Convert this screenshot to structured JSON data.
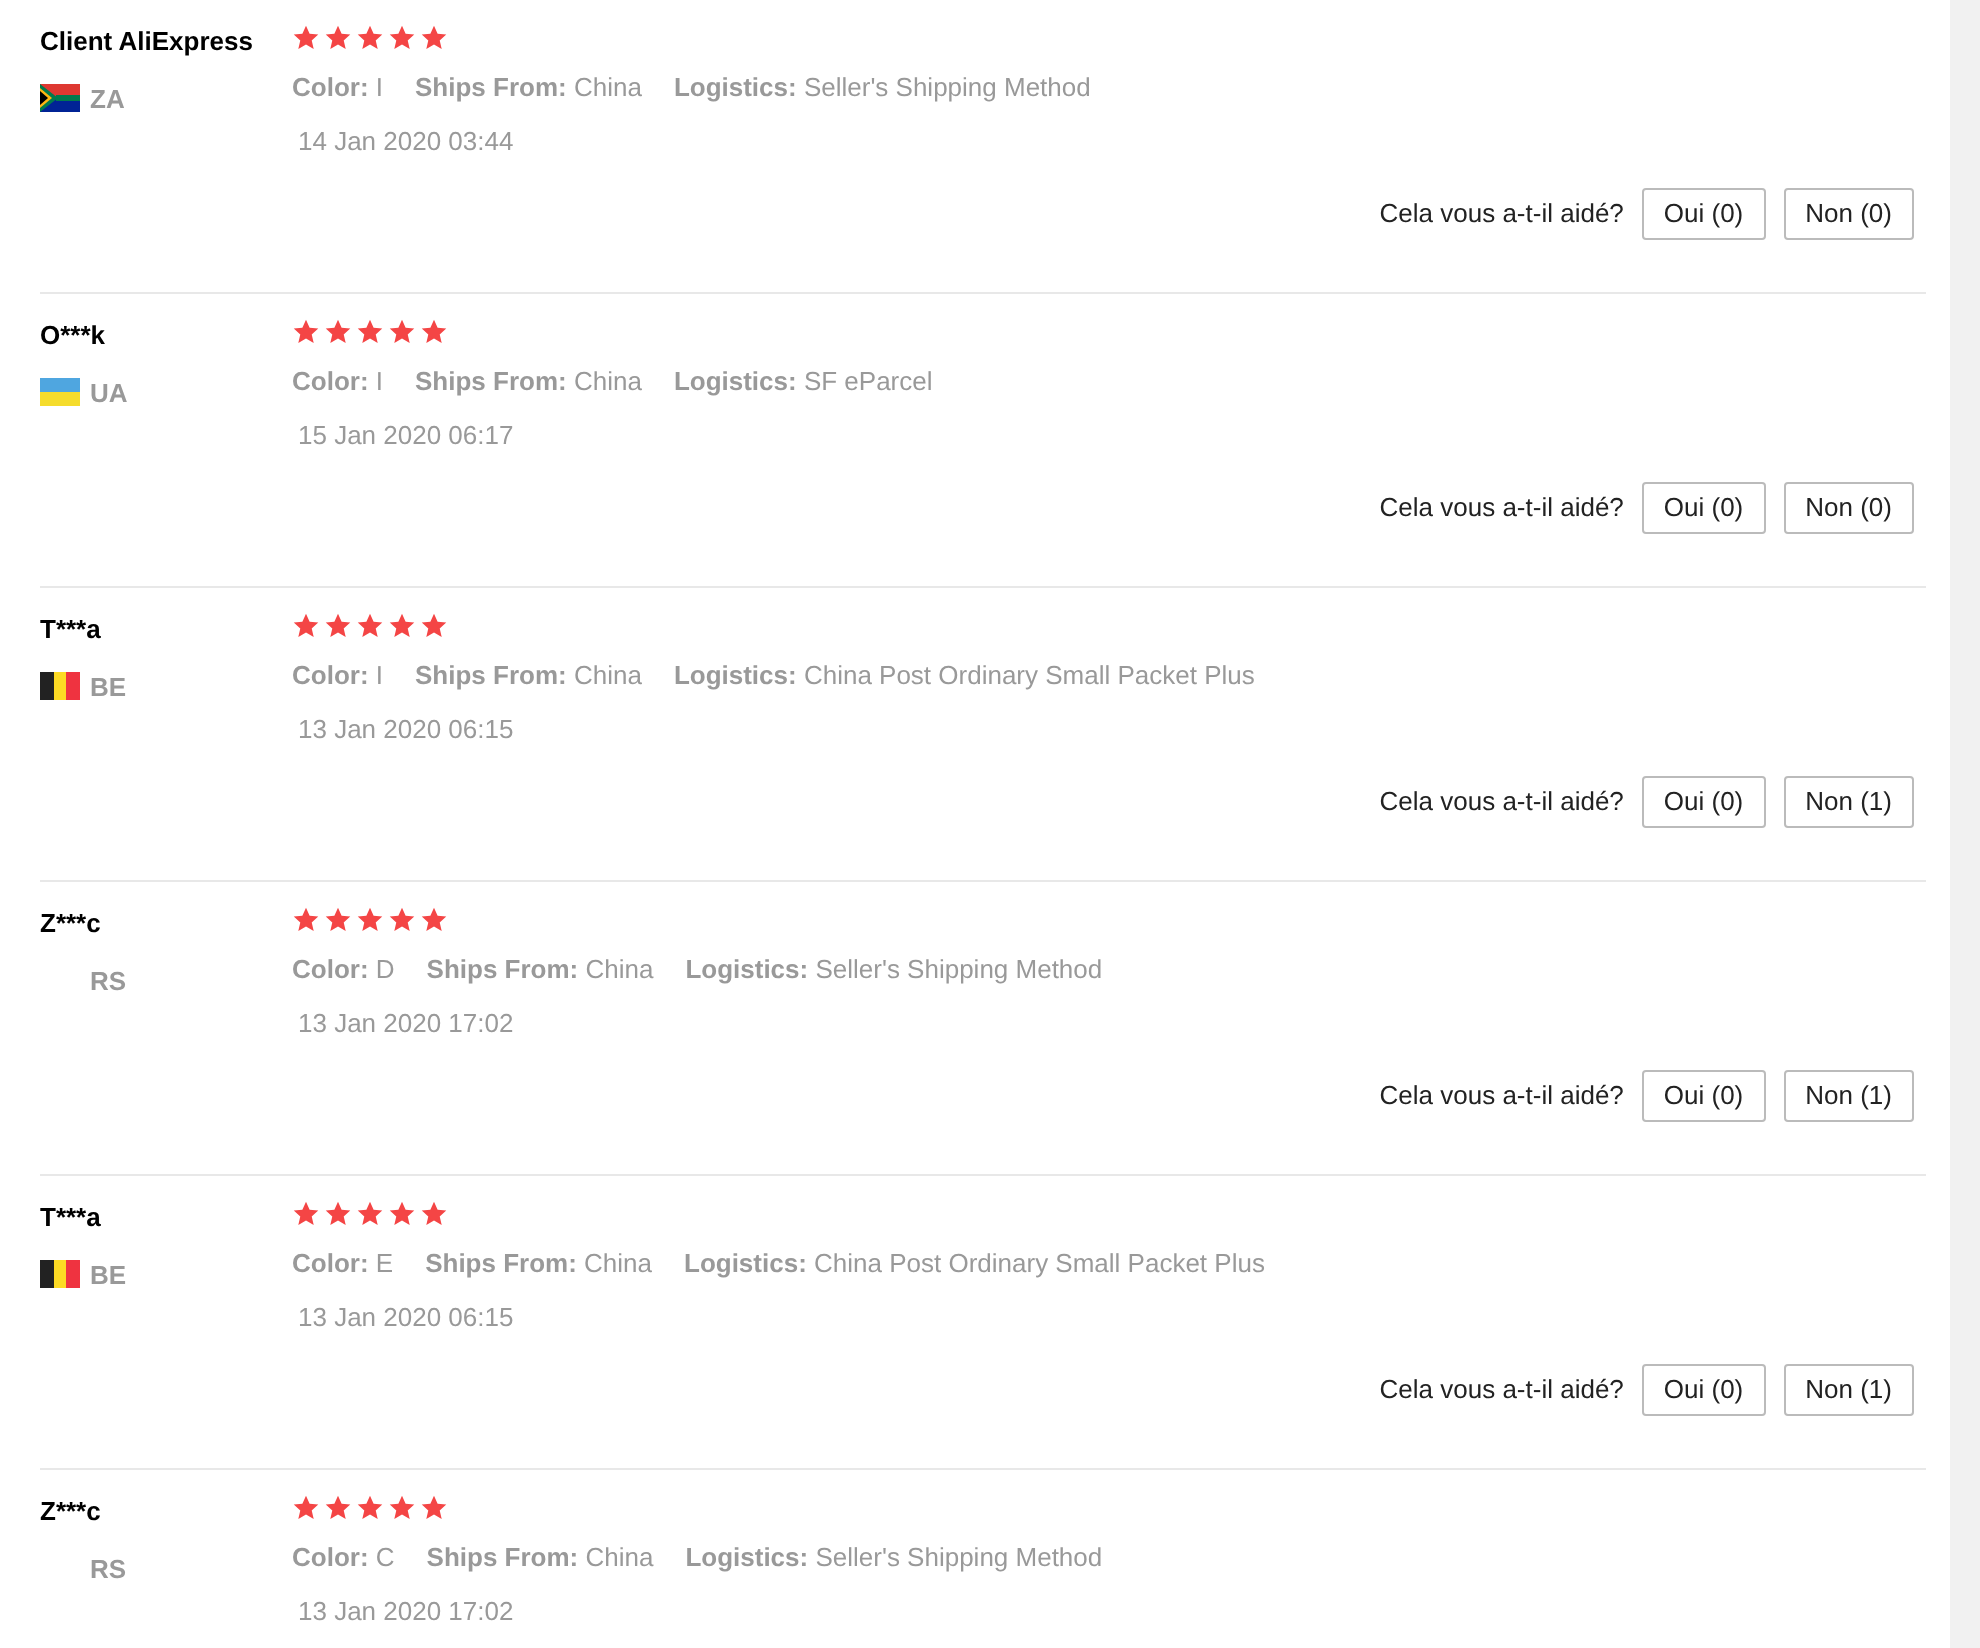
{
  "reviews": [
    {
      "name": "Client AliExpress",
      "flag": {
        "kind": "za"
      },
      "country": "ZA",
      "stars": 5,
      "details": [
        "**Color:** I",
        "**Ships From:** China",
        "**Logistics:** Seller's Shipping Method"
      ],
      "date": "14 Jan 2020 03:44",
      "helpful": {
        "question": "Cela vous a-t-il aidé?",
        "yes": "Oui (0)",
        "no": "Non (0)"
      }
    },
    {
      "name": "O***k",
      "flag": {
        "kind": "ua"
      },
      "country": "UA",
      "stars": 5,
      "details": [
        "**Color:** I",
        "**Ships From:** China",
        "**Logistics:** SF eParcel"
      ],
      "date": "15 Jan 2020 06:17",
      "helpful": {
        "question": "Cela vous a-t-il aidé?",
        "yes": "Oui (0)",
        "no": "Non (0)"
      }
    },
    {
      "name": "T***a",
      "flag": {
        "kind": "be"
      },
      "country": "BE",
      "stars": 5,
      "details": [
        "**Color:** I",
        "**Ships From:** China",
        "**Logistics:** China Post Ordinary Small Packet Plus"
      ],
      "date": "13 Jan 2020 06:15",
      "helpful": {
        "question": "Cela vous a-t-il aidé?",
        "yes": "Oui (0)",
        "no": "Non (1)"
      }
    },
    {
      "name": "Z***c",
      "country": "RS",
      "stars": 5,
      "details": [
        "**Color:** D",
        "**Ships From:** China",
        "**Logistics:** Seller's Shipping Method"
      ],
      "date": "13 Jan 2020 17:02",
      "helpful": {
        "question": "Cela vous a-t-il aidé?",
        "yes": "Oui (0)",
        "no": "Non (1)"
      }
    },
    {
      "name": "T***a",
      "flag": {
        "kind": "be"
      },
      "country": "BE",
      "stars": 5,
      "details": [
        "**Color:** E",
        "**Ships From:** China",
        "**Logistics:** China Post Ordinary Small Packet Plus"
      ],
      "date": "13 Jan 2020 06:15",
      "helpful": {
        "question": "Cela vous a-t-il aidé?",
        "yes": "Oui (0)",
        "no": "Non (1)"
      }
    },
    {
      "name": "Z***c",
      "country": "RS",
      "stars": 5,
      "details": [
        "**Color:** C",
        "**Ships From:** China",
        "**Logistics:** Seller's Shipping Method"
      ],
      "date": "13 Jan 2020 17:02"
    }
  ]
}
